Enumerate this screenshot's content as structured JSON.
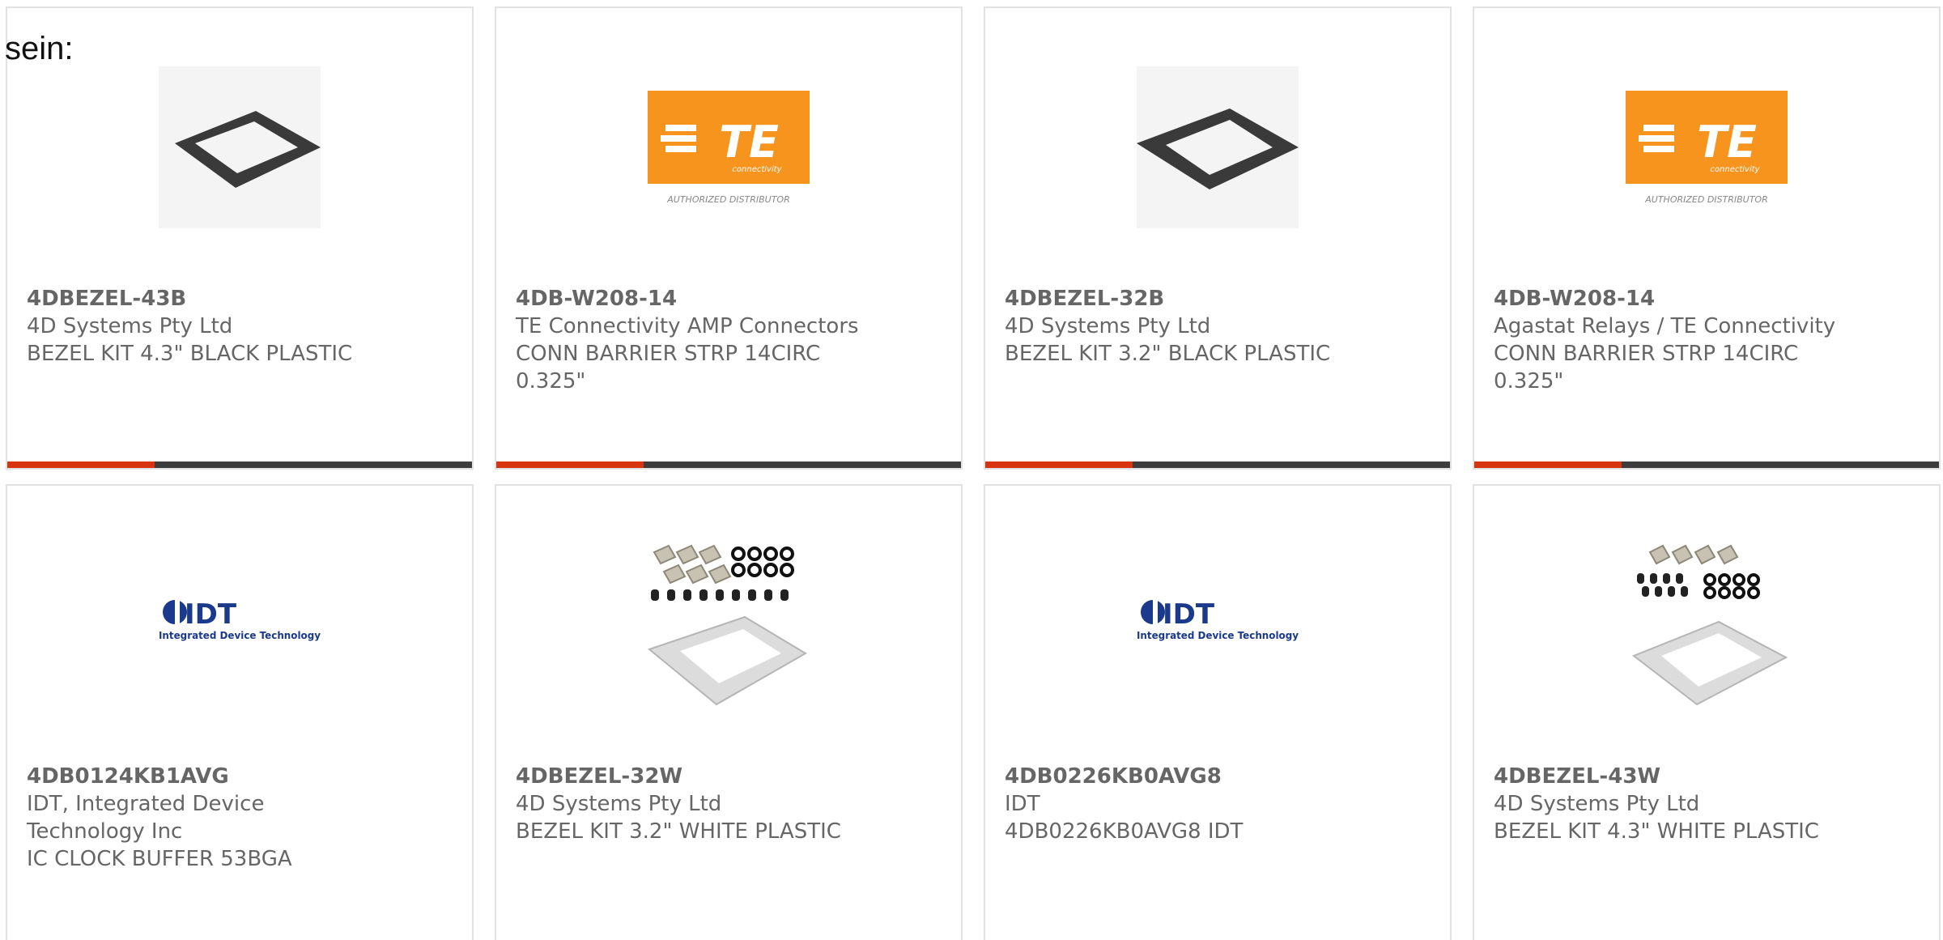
{
  "lead_text": "sein:",
  "products": [
    {
      "part_number": "4DBEZEL-43B",
      "lines": [
        "4D Systems Pty Ltd",
        "BEZEL KIT 4.3\" BLACK PLASTIC"
      ],
      "image": "bezel-black-icon"
    },
    {
      "part_number": "4DB-W208-14",
      "lines": [
        "TE Connectivity AMP Connectors",
        "CONN BARRIER STRP 14CIRC",
        "0.325\""
      ],
      "image": "te-logo-icon",
      "logo_text": "TE",
      "logo_sub": "connectivity",
      "logo_caption": "AUTHORIZED DISTRIBUTOR"
    },
    {
      "part_number": "4DBEZEL-32B",
      "lines": [
        "4D Systems Pty Ltd",
        "BEZEL KIT 3.2\" BLACK PLASTIC"
      ],
      "image": "bezel-black-icon"
    },
    {
      "part_number": "4DB-W208-14",
      "lines": [
        "Agastat Relays / TE Connectivity",
        "CONN BARRIER STRP 14CIRC",
        "0.325\""
      ],
      "image": "te-logo-icon",
      "logo_text": "TE",
      "logo_sub": "connectivity",
      "logo_caption": "AUTHORIZED DISTRIBUTOR"
    },
    {
      "part_number": "4DB0124KB1AVG",
      "lines": [
        "IDT, Integrated Device",
        "Technology Inc",
        "IC CLOCK BUFFER 53BGA"
      ],
      "image": "idt-logo-icon",
      "logo_text": "IDT",
      "logo_sub": "Integrated Device Technology"
    },
    {
      "part_number": "4DBEZEL-32W",
      "lines": [
        "4D Systems Pty Ltd",
        "BEZEL KIT 3.2\" WHITE PLASTIC"
      ],
      "image": "bezel-white-kit-icon"
    },
    {
      "part_number": "4DB0226KB0AVG8",
      "lines": [
        "IDT",
        "4DB0226KB0AVG8 IDT"
      ],
      "image": "idt-logo-icon",
      "logo_text": "IDT",
      "logo_sub": "Integrated Device Technology"
    },
    {
      "part_number": "4DBEZEL-43W",
      "lines": [
        "4D Systems Pty Ltd",
        "BEZEL KIT 4.3\" WHITE PLASTIC"
      ],
      "image": "bezel-white-kit-icon"
    }
  ],
  "colors": {
    "accent_red": "#d8340f",
    "accent_dark": "#3d3d3d",
    "te_orange": "#f7941d",
    "idt_blue": "#1b3a8c",
    "text_gray": "#666666"
  }
}
